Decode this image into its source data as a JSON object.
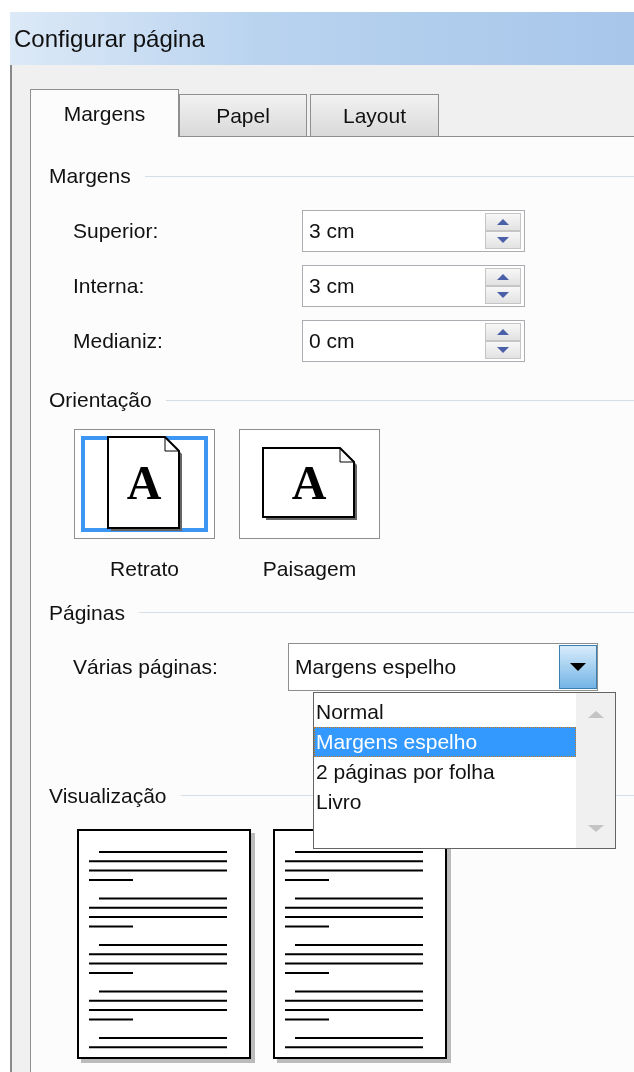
{
  "window": {
    "title": "Configurar página"
  },
  "tabs": [
    {
      "label": "Margens",
      "selected": true
    },
    {
      "label": "Papel",
      "selected": false
    },
    {
      "label": "Layout",
      "selected": false
    }
  ],
  "sections": [
    {
      "kind": "margins",
      "title": "Margens",
      "fields": [
        {
          "label": "Superior:",
          "value": "3 cm"
        },
        {
          "label": "Interna:",
          "value": "3 cm"
        },
        {
          "label": "Medianiz:",
          "value": "0 cm"
        }
      ]
    },
    {
      "kind": "orientation",
      "title": "Orientação",
      "options": [
        {
          "label": "Retrato",
          "glyph": "A",
          "selected": true
        },
        {
          "label": "Paisagem",
          "glyph": "A",
          "selected": false
        }
      ]
    },
    {
      "kind": "pages",
      "title": "Páginas",
      "label": "Várias páginas:",
      "value": "Margens espelho",
      "expanded": true,
      "options": [
        {
          "label": "Normal",
          "selected": false
        },
        {
          "label": "Margens espelho",
          "selected": true
        },
        {
          "label": "2 páginas por folha",
          "selected": false
        },
        {
          "label": "Livro",
          "selected": false
        }
      ]
    },
    {
      "kind": "preview",
      "title": "Visualização"
    }
  ]
}
